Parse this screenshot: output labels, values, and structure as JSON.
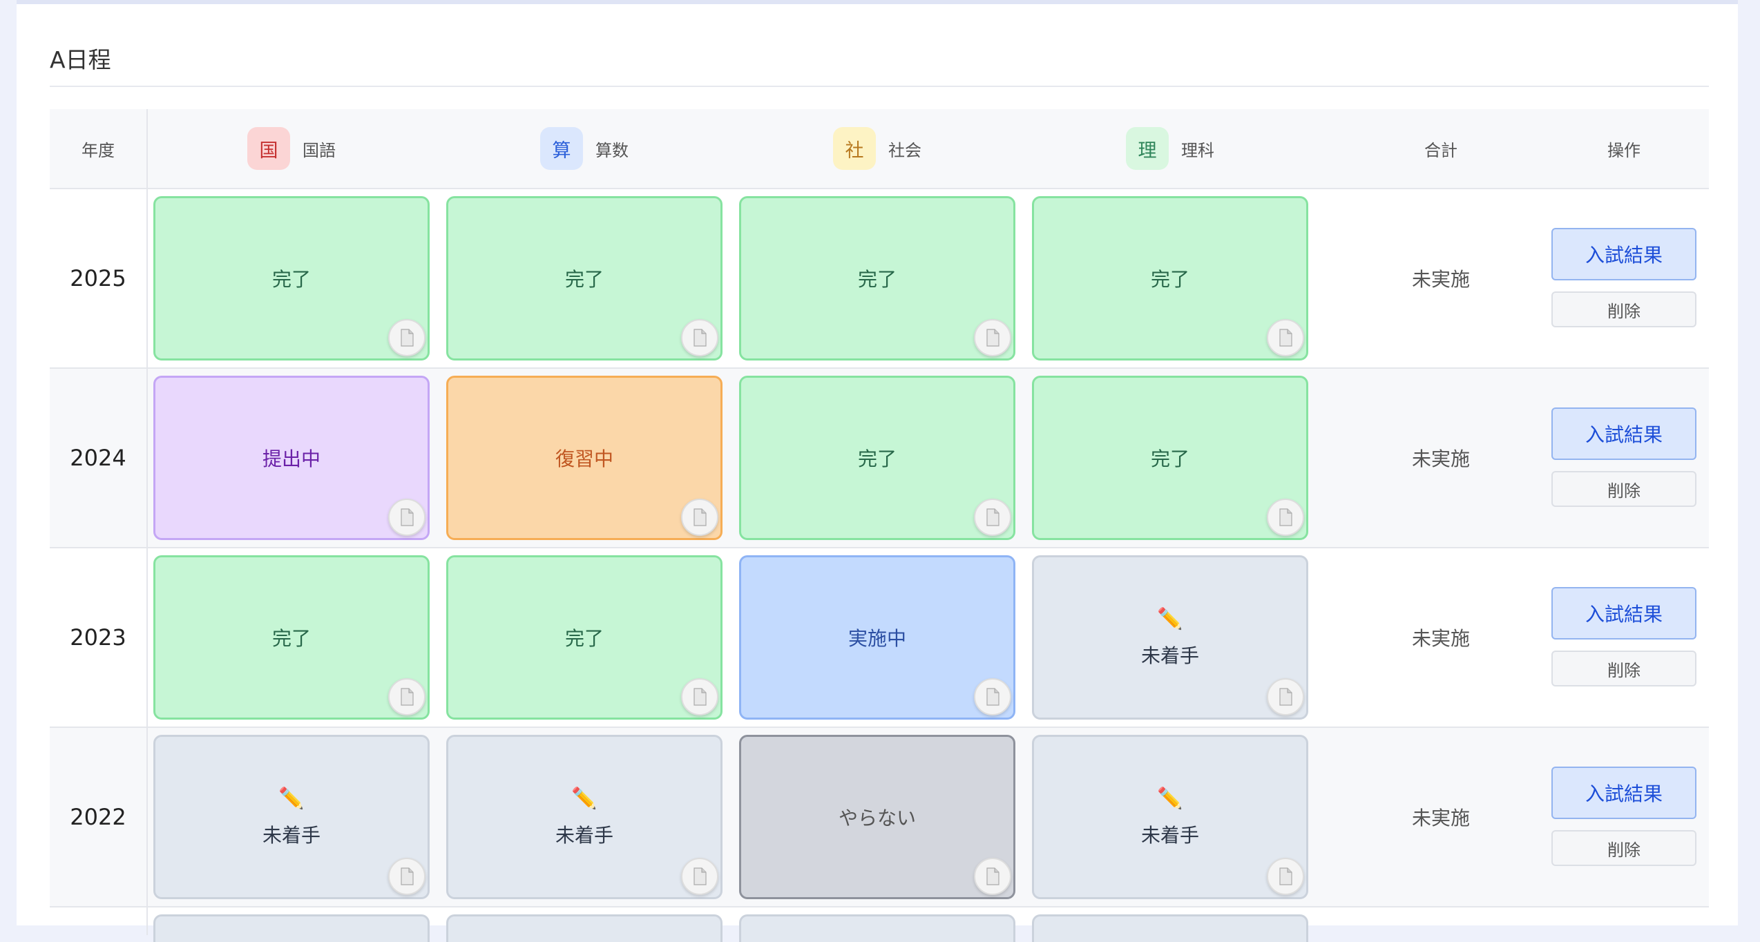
{
  "section": {
    "title": "A日程"
  },
  "header": {
    "year": "年度",
    "subjects": [
      {
        "badge": "国",
        "label": "国語",
        "badge_bg": "#fbd5d5",
        "badge_fg": "#c53030"
      },
      {
        "badge": "算",
        "label": "算数",
        "badge_bg": "#dbe7fd",
        "badge_fg": "#2b5fd9"
      },
      {
        "badge": "社",
        "label": "社会",
        "badge_bg": "#fdf3c4",
        "badge_fg": "#b7791f"
      },
      {
        "badge": "理",
        "label": "理科",
        "badge_bg": "#d9f7e0",
        "badge_fg": "#2f855a"
      }
    ],
    "total": "合計",
    "actions": "操作"
  },
  "rows": [
    {
      "year": "2025",
      "cells": [
        {
          "status": "done",
          "label": "完了"
        },
        {
          "status": "done",
          "label": "完了"
        },
        {
          "status": "done",
          "label": "完了"
        },
        {
          "status": "done",
          "label": "完了"
        }
      ],
      "total": "未実施",
      "result_button": "入試結果",
      "delete_button": "削除"
    },
    {
      "year": "2024",
      "cells": [
        {
          "status": "submit",
          "label": "提出中"
        },
        {
          "status": "review",
          "label": "復習中"
        },
        {
          "status": "done",
          "label": "完了"
        },
        {
          "status": "done",
          "label": "完了"
        }
      ],
      "total": "未実施",
      "result_button": "入試結果",
      "delete_button": "削除"
    },
    {
      "year": "2023",
      "cells": [
        {
          "status": "done",
          "label": "完了"
        },
        {
          "status": "done",
          "label": "完了"
        },
        {
          "status": "doing",
          "label": "実施中"
        },
        {
          "status": "todo",
          "label": "未着手",
          "icon": "pencil-icon"
        }
      ],
      "total": "未実施",
      "result_button": "入試結果",
      "delete_button": "削除"
    },
    {
      "year": "2022",
      "cells": [
        {
          "status": "todo",
          "label": "未着手",
          "icon": "pencil-icon"
        },
        {
          "status": "todo",
          "label": "未着手",
          "icon": "pencil-icon"
        },
        {
          "status": "skip",
          "label": "やらない"
        },
        {
          "status": "todo",
          "label": "未着手",
          "icon": "pencil-icon"
        }
      ],
      "total": "未実施",
      "result_button": "入試結果",
      "delete_button": "削除"
    }
  ],
  "colors": {
    "done": "#c6f6d5",
    "submit": "#e9d8fd",
    "review": "#fbd7a9",
    "doing": "#c3dafe",
    "todo": "#e2e8f0",
    "skip": "#d3d6dd"
  }
}
